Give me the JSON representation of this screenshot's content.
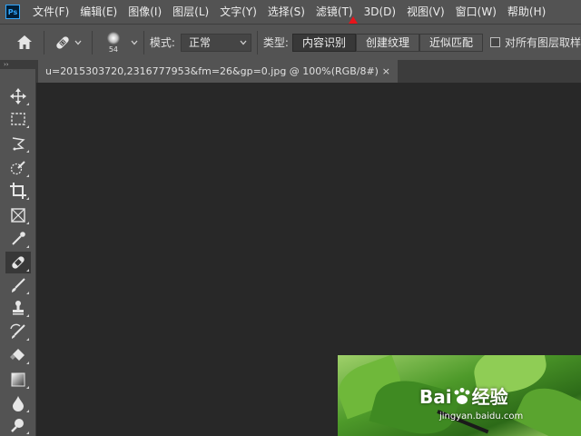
{
  "app": {
    "logo_text": "Ps",
    "menu": [
      "文件(F)",
      "编辑(E)",
      "图像(I)",
      "图层(L)",
      "文字(Y)",
      "选择(S)",
      "滤镜(T)",
      "3D(D)",
      "视图(V)",
      "窗口(W)",
      "帮助(H)"
    ]
  },
  "options": {
    "brush_size": "54",
    "mode_label": "模式:",
    "mode_value": "正常",
    "type_label": "类型:",
    "type_buttons": [
      "内容识别",
      "创建纹理",
      "近似匹配"
    ],
    "sample_all_label": "对所有图层取样"
  },
  "tools_header": "››",
  "document": {
    "tab_title": "u=2015303720,2316777953&fm=26&gp=0.jpg @ 100%(RGB/8#)",
    "close": "×"
  },
  "watermark": {
    "brand": "Bai",
    "brand_tail": "经验",
    "url": "jingyan.baidu.com"
  },
  "colors": {
    "menubar": "#535353",
    "canvas": "#282828",
    "annotation": "#e8141b"
  }
}
